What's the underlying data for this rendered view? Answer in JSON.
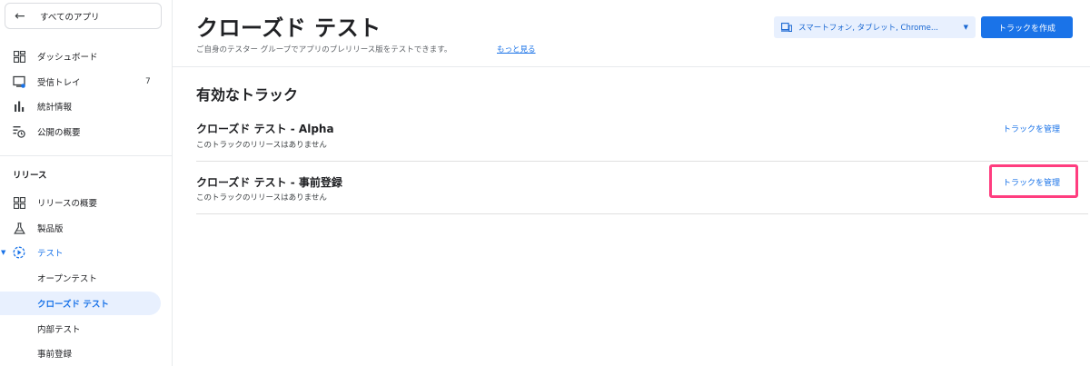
{
  "sidebar": {
    "back_label": "すべてのアプリ",
    "items": [
      {
        "label": "ダッシュボード",
        "icon": "dashboard-icon"
      },
      {
        "label": "受信トレイ",
        "icon": "inbox-icon",
        "badge": "7"
      },
      {
        "label": "統計情報",
        "icon": "bar-chart-icon"
      },
      {
        "label": "公開の概要",
        "icon": "publishing-overview-icon"
      }
    ],
    "release_section": "リリース",
    "release_items": [
      {
        "label": "リリースの概要",
        "icon": "release-overview-icon"
      },
      {
        "label": "製品版",
        "icon": "production-flask-icon"
      },
      {
        "label": "テスト",
        "icon": "testing-icon"
      }
    ],
    "test_sub_items": [
      {
        "label": "オープンテスト"
      },
      {
        "label": "クローズド テスト"
      },
      {
        "label": "内部テスト"
      },
      {
        "label": "事前登録"
      }
    ]
  },
  "header": {
    "title": "クローズド テスト",
    "description": "ご自身のテスター グループでアプリのプレリリース版をテストできます。",
    "learn_more": "もっと見る",
    "device_filter": "スマートフォン, タブレット, Chrome...",
    "create_button": "トラックを作成"
  },
  "main": {
    "section_title": "有効なトラック",
    "tracks": [
      {
        "name": "クローズド テスト - Alpha",
        "subtitle": "このトラックのリリースはありません",
        "action": "トラックを管理"
      },
      {
        "name": "クローズド テスト - 事前登録",
        "subtitle": "このトラックのリリースはありません",
        "action": "トラックを管理"
      }
    ]
  },
  "colors": {
    "accent": "#1a73e8",
    "selected_bg": "#e8f0fe",
    "highlight": "#ff3d7f"
  }
}
